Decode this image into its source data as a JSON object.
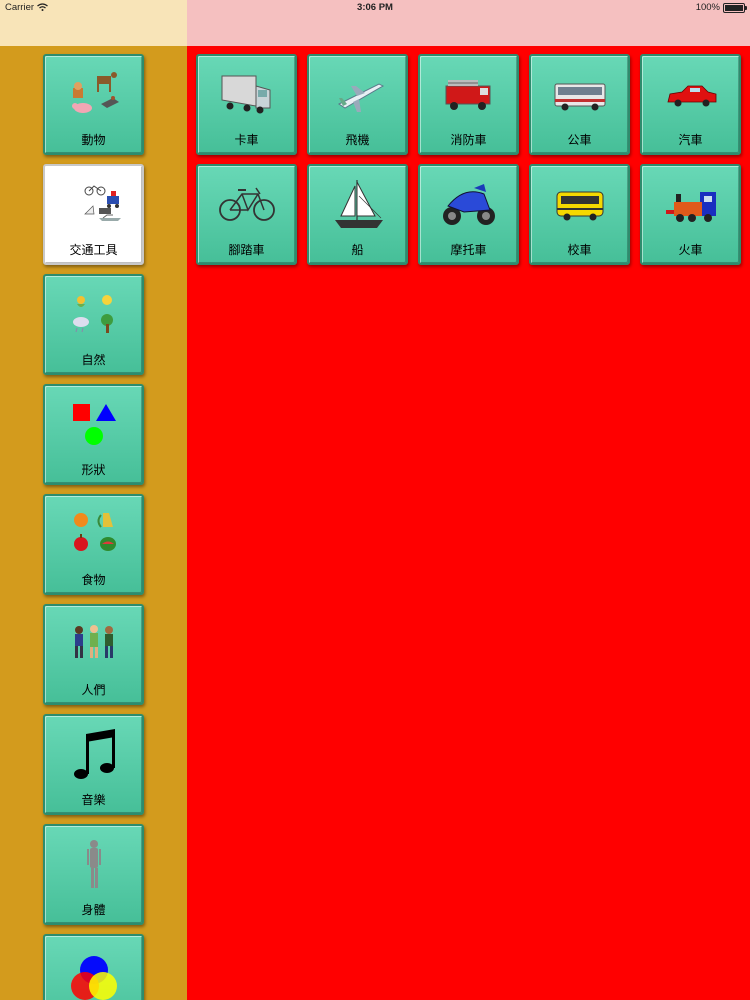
{
  "status_bar": {
    "carrier": "Carrier",
    "time": "3:06 PM",
    "battery": "100%"
  },
  "colors": {
    "sidebar_bg": "#d39b1d",
    "content_bg": "#ff0000",
    "tile_green": "#55ca9e",
    "status_left_bg": "#f8e4b8",
    "status_right_bg": "#f5c0c0"
  },
  "sidebar": {
    "selected_index": 1,
    "items": [
      {
        "label": "動物",
        "icon": "animals-icon"
      },
      {
        "label": "交通工具",
        "icon": "transport-icon"
      },
      {
        "label": "自然",
        "icon": "nature-icon"
      },
      {
        "label": "形狀",
        "icon": "shapes-icon"
      },
      {
        "label": "食物",
        "icon": "food-icon"
      },
      {
        "label": "人們",
        "icon": "people-icon"
      },
      {
        "label": "音樂",
        "icon": "music-note-icon"
      },
      {
        "label": "身體",
        "icon": "body-icon"
      },
      {
        "label": "",
        "icon": "color-circles-icon"
      }
    ]
  },
  "grid": {
    "items": [
      {
        "label": "卡車",
        "icon": "truck-icon"
      },
      {
        "label": "飛機",
        "icon": "airplane-icon"
      },
      {
        "label": "消防車",
        "icon": "fire-truck-icon"
      },
      {
        "label": "公車",
        "icon": "bus-icon"
      },
      {
        "label": "汽車",
        "icon": "car-icon"
      },
      {
        "label": "腳踏車",
        "icon": "bicycle-icon"
      },
      {
        "label": "船",
        "icon": "sailboat-icon"
      },
      {
        "label": "摩托車",
        "icon": "motorcycle-icon"
      },
      {
        "label": "校車",
        "icon": "school-bus-icon"
      },
      {
        "label": "火車",
        "icon": "train-icon"
      }
    ]
  }
}
